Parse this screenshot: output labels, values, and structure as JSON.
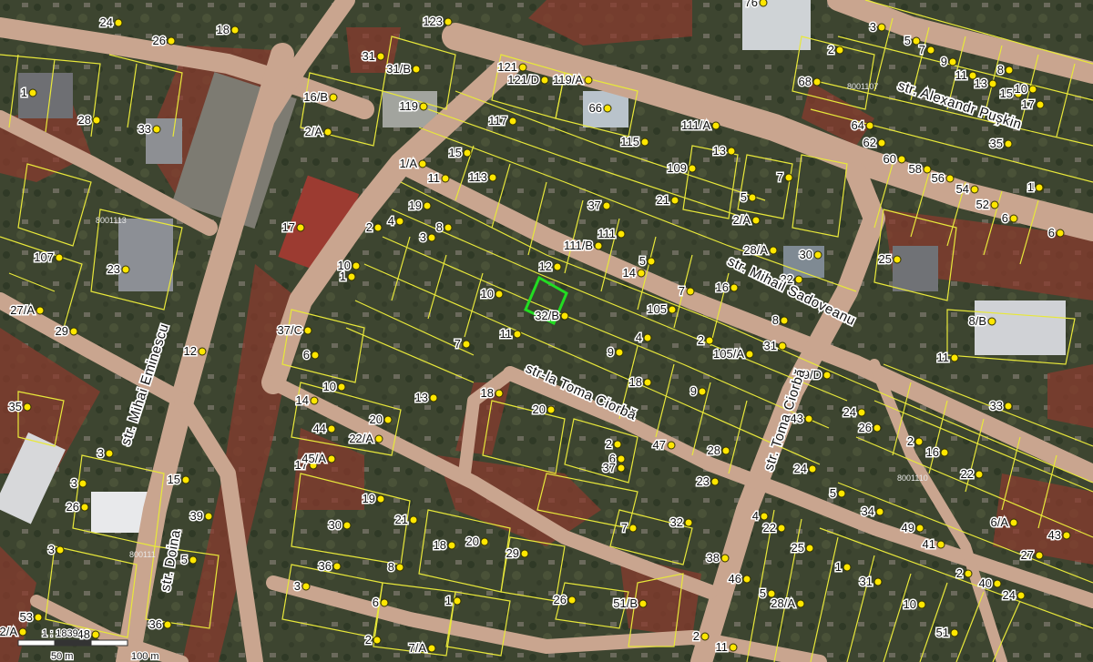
{
  "colors": {
    "terrain": "#3d4530",
    "road": "#c9a58f",
    "public_domain": "#8a3a2e",
    "parcel_line": "#e8e83a",
    "point": "#ffe600",
    "selected_parcel": "#22dd22"
  },
  "streets": [
    {
      "id": "alexandr-puskin",
      "name": "str. Alexandr Pușkin"
    },
    {
      "id": "mihail-sadoveanu",
      "name": "str. Mihail Sadoveanu"
    },
    {
      "id": "toma-ciorba-vertical",
      "name": "str. Toma Ciorbă"
    },
    {
      "id": "la-toma-ciorba",
      "name": "str-la Toma Ciorbă"
    },
    {
      "id": "mihai-eminescu",
      "name": "str. Mihai Eminescu"
    },
    {
      "id": "doina",
      "name": "str. Doina"
    }
  ],
  "sector_codes": [
    "8001107",
    "8001113",
    "8001110",
    "800111"
  ],
  "parcels": [
    "24",
    "26",
    "18",
    "123",
    "76",
    "3",
    "5",
    "7",
    "9",
    "11",
    "13",
    "15",
    "17",
    "8",
    "10",
    "2",
    "31",
    "31/B",
    "121",
    "121/D",
    "119/A",
    "68",
    "1",
    "28",
    "33",
    "16/B",
    "119",
    "66",
    "64",
    "62",
    "60",
    "58",
    "56",
    "54",
    "52",
    "6",
    "4",
    "35",
    "2/A",
    "117",
    "115",
    "111/A",
    "13",
    "15",
    "1/A",
    "11",
    "113",
    "109",
    "7",
    "6",
    "1",
    "37",
    "21",
    "17",
    "2",
    "4",
    "19",
    "8",
    "3",
    "111",
    "111/B",
    "5",
    "2/A",
    "28/A",
    "30",
    "107",
    "23",
    "25",
    "10",
    "1",
    "5",
    "12",
    "14",
    "7",
    "16",
    "105",
    "8",
    "8/B",
    "10",
    "7",
    "32/B",
    "32",
    "27/A",
    "29",
    "37/C",
    "6",
    "12",
    "11",
    "9",
    "4",
    "2",
    "105/A",
    "31",
    "11",
    "10",
    "18",
    "13",
    "14",
    "9",
    "18",
    "20",
    "9/D",
    "44",
    "33",
    "35",
    "20",
    "22/A",
    "24",
    "26",
    "2",
    "16",
    "15",
    "28",
    "43",
    "24",
    "22",
    "3",
    "17",
    "45/A",
    "2",
    "5",
    "3",
    "6",
    "47",
    "37",
    "39",
    "26",
    "19",
    "21",
    "30",
    "23",
    "34",
    "49",
    "6/A",
    "41",
    "43",
    "3",
    "5",
    "18",
    "20",
    "32",
    "4",
    "22",
    "25",
    "27",
    "29",
    "1",
    "2",
    "40",
    "24",
    "36",
    "7",
    "8",
    "31",
    "3",
    "38",
    "46",
    "5",
    "6",
    "1",
    "26",
    "28/A",
    "51/B",
    "10",
    "51",
    "53",
    "36",
    "48",
    "2/A",
    "2",
    "7/A",
    "2",
    "11"
  ],
  "scale": {
    "ratio_label": "1 : 1839",
    "tick_50": "50 m",
    "tick_100": "100 m"
  }
}
